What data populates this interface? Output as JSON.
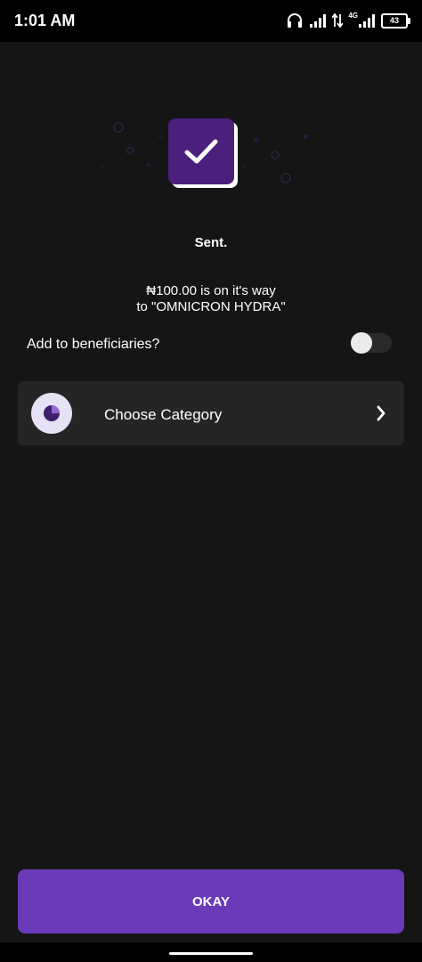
{
  "status_bar": {
    "time": "1:01 AM",
    "network_label": "4G",
    "battery": "43"
  },
  "confirmation": {
    "title": "Sent.",
    "message_line1": "₦100.00 is on it's way",
    "message_line2": "to \"OMNICRON HYDRA\""
  },
  "beneficiary": {
    "label": "Add to beneficiaries?",
    "toggle_on": false
  },
  "category": {
    "label": "Choose Category"
  },
  "actions": {
    "okay_label": "OKAY"
  },
  "colors": {
    "accent": "#6a3ab8",
    "check_box": "#4b1f7c",
    "background": "#151515",
    "card": "#252525"
  },
  "icons": {
    "success": "checkmark-icon",
    "category": "pie-chart-icon",
    "navigate": "chevron-right-icon"
  }
}
